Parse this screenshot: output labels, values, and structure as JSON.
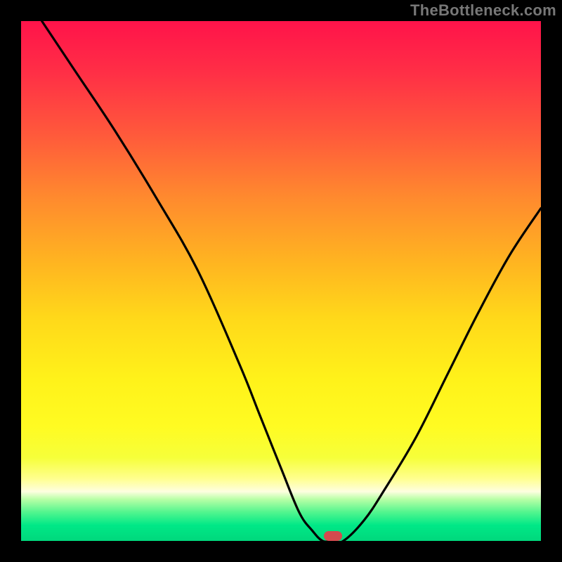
{
  "attribution": "TheBottleneck.com",
  "colors": {
    "frame_bg": "#000000",
    "curve_stroke": "#000000",
    "marker_fill": "#d34a4e"
  },
  "chart_data": {
    "type": "line",
    "title": "",
    "xlabel": "",
    "ylabel": "",
    "xlim": [
      0,
      100
    ],
    "ylim": [
      0,
      100
    ],
    "grid": false,
    "series": [
      {
        "name": "bottleneck-curve",
        "x": [
          4,
          10,
          18,
          26,
          34,
          42,
          46,
          50,
          53.5,
          56,
          58,
          60,
          62,
          66,
          70,
          76,
          82,
          88,
          94,
          100
        ],
        "values": [
          100,
          91,
          79,
          66,
          52,
          34,
          24,
          14,
          5.5,
          2,
          0,
          0,
          0,
          4,
          10,
          20,
          32,
          44,
          55,
          64
        ]
      }
    ],
    "annotations": [
      {
        "name": "min-marker",
        "x": 60,
        "y": 1
      }
    ]
  }
}
